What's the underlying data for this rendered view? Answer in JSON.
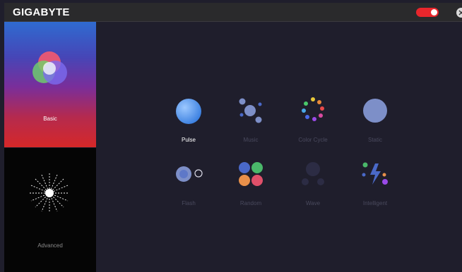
{
  "app": {
    "brand": "GIGABYTE"
  },
  "sidebar": {
    "items": [
      {
        "label": "Basic"
      },
      {
        "label": "Advanced"
      }
    ]
  },
  "effects": [
    {
      "label": "Pulse",
      "icon": "pulse-icon",
      "active": true
    },
    {
      "label": "Music",
      "icon": "music-icon",
      "active": false
    },
    {
      "label": "Color Cycle",
      "icon": "color-cycle-icon",
      "active": false
    },
    {
      "label": "Static",
      "icon": "static-icon",
      "active": false
    },
    {
      "label": "Flash",
      "icon": "flash-icon",
      "active": false
    },
    {
      "label": "Random",
      "icon": "random-icon",
      "active": false
    },
    {
      "label": "Wave",
      "icon": "wave-icon",
      "active": false
    },
    {
      "label": "Intelligent",
      "icon": "intelligent-icon",
      "active": false
    }
  ],
  "colors": {
    "accent": "#e8262c",
    "background": "#1f1e2c",
    "label_active": "#ffffff",
    "label_inactive": "#4a4a5e"
  }
}
